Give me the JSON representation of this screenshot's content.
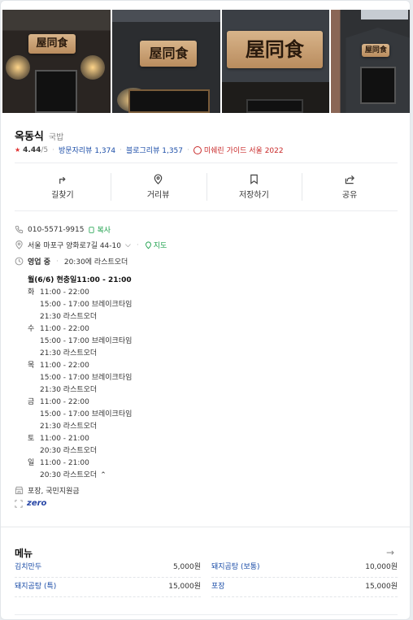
{
  "place": {
    "name": "옥동식",
    "category": "국밥",
    "rating": "4.44",
    "rating_max": "/5",
    "visitor_review_label": "방문자리뷰",
    "visitor_review_count": "1,374",
    "blog_review_label": "블로그리뷰",
    "blog_review_count": "1,357",
    "michelin_label": "미쉐린 가이드 서울 2022"
  },
  "photos": {
    "sign_text": "屋同食",
    "sign_text_small": "屋同食"
  },
  "actions": [
    {
      "label": "길찾기",
      "icon": "directions-icon"
    },
    {
      "label": "거리뷰",
      "icon": "location-pin-icon"
    },
    {
      "label": "저장하기",
      "icon": "bookmark-icon"
    },
    {
      "label": "공유",
      "icon": "share-icon"
    }
  ],
  "info": {
    "phone": "010-5571-9915",
    "copy_label": "복사",
    "address": "서울 마포구 양화로7길 44-10",
    "map_label": "지도",
    "status": "영업 중",
    "status_detail": "20:30에 라스트오더",
    "facilities": "포장, 국민지원금",
    "zero_pay": "zero"
  },
  "hours": {
    "today_line": "월(6/6)  현충일11:00 - 21:00",
    "days": [
      {
        "day": "화",
        "lines": [
          "11:00 - 22:00",
          "15:00 - 17:00 브레이크타임",
          "21:30 라스트오더"
        ]
      },
      {
        "day": "수",
        "lines": [
          "11:00 - 22:00",
          "15:00 - 17:00 브레이크타임",
          "21:30 라스트오더"
        ]
      },
      {
        "day": "목",
        "lines": [
          "11:00 - 22:00",
          "15:00 - 17:00 브레이크타임",
          "21:30 라스트오더"
        ]
      },
      {
        "day": "금",
        "lines": [
          "11:00 - 22:00",
          "15:00 - 17:00 브레이크타임",
          "21:30 라스트오더"
        ]
      },
      {
        "day": "토",
        "lines": [
          "11:00 - 21:00",
          "20:30 라스트오더"
        ]
      },
      {
        "day": "일",
        "lines": [
          "11:00 - 21:00",
          "20:30 라스트오더"
        ]
      }
    ]
  },
  "menu": {
    "title": "메뉴",
    "items": [
      {
        "name": "김치만두",
        "price": "5,000원"
      },
      {
        "name": "돼지곰탕 (보통)",
        "price": "10,000원"
      },
      {
        "name": "돼지곰탕 (특)",
        "price": "15,000원"
      },
      {
        "name": "포장",
        "price": "15,000원"
      }
    ]
  },
  "colors": {
    "link": "#1c4ea8",
    "michelin": "#c92a2a",
    "open_green": "#1fa14d",
    "zero_pay": "#2746a6"
  }
}
